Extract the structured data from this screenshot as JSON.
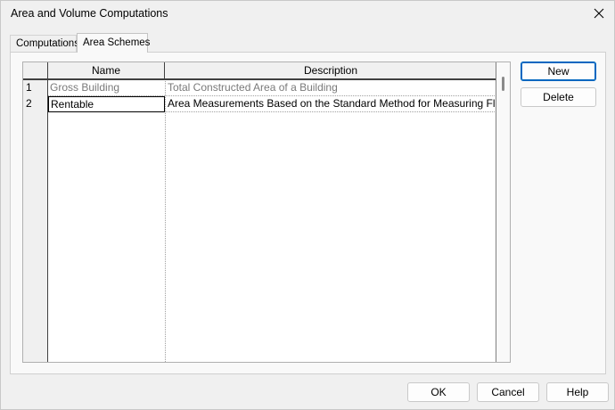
{
  "window": {
    "title": "Area and Volume Computations"
  },
  "tabs": [
    {
      "label": "Computations",
      "active": false
    },
    {
      "label": "Area Schemes",
      "active": true
    }
  ],
  "table": {
    "columns": [
      "Name",
      "Description"
    ],
    "rows": [
      {
        "num": "1",
        "name": "Gross Building",
        "description": "Total Constructed Area of a Building"
      },
      {
        "num": "2",
        "name": "Rentable",
        "description": "Area Measurements Based on the Standard Method for Measuring Floor"
      }
    ]
  },
  "side_buttons": {
    "new_label": "New",
    "delete_label": "Delete"
  },
  "footer": {
    "ok_label": "OK",
    "cancel_label": "Cancel",
    "help_label": "Help"
  },
  "icons": {
    "close": "close-icon"
  },
  "colors": {
    "accent": "#0067c0",
    "dimmed_text": "#7a7a7a"
  }
}
